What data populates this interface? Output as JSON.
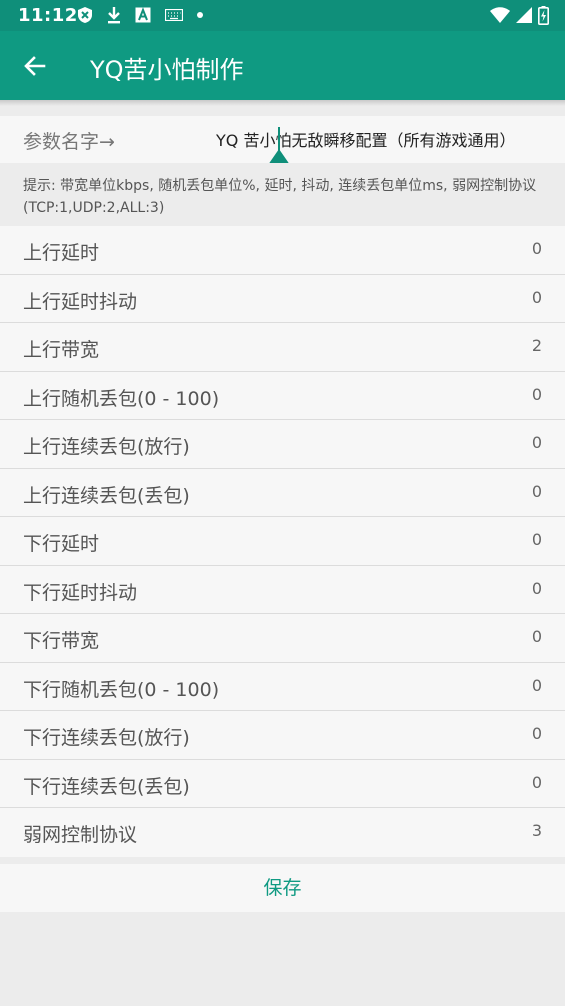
{
  "status_bar": {
    "time": "11:12",
    "left_icons": [
      "shield-x-icon",
      "download-icon",
      "a-box-icon",
      "keyboard-icon",
      "dot-icon"
    ],
    "right_icons": [
      "wifi-icon",
      "signal-icon",
      "battery-charging-icon"
    ]
  },
  "app_bar": {
    "title": "YQ苦小怕制作",
    "back_icon": "arrow-left-icon",
    "color": "#0f9a82"
  },
  "param": {
    "label": "参数名字→",
    "value": "YQ 苦小怕无敌瞬移配置（所有游戏通用）"
  },
  "hint": "提示: 带宽单位kbps, 随机丢包单位%, 延时, 抖动, 连续丢包单位ms, 弱网控制协议(TCP:1,UDP:2,ALL:3)",
  "settings": [
    {
      "label": "上行延时",
      "value": "0"
    },
    {
      "label": "上行延时抖动",
      "value": "0"
    },
    {
      "label": "上行带宽",
      "value": "2"
    },
    {
      "label": "上行随机丢包(0 - 100)",
      "value": "0"
    },
    {
      "label": "上行连续丢包(放行)",
      "value": "0"
    },
    {
      "label": "上行连续丢包(丢包)",
      "value": "0"
    },
    {
      "label": "下行延时",
      "value": "0"
    },
    {
      "label": "下行延时抖动",
      "value": "0"
    },
    {
      "label": "下行带宽",
      "value": "0"
    },
    {
      "label": "下行随机丢包(0 - 100)",
      "value": "0"
    },
    {
      "label": "下行连续丢包(放行)",
      "value": "0"
    },
    {
      "label": "下行连续丢包(丢包)",
      "value": "0"
    },
    {
      "label": "弱网控制协议",
      "value": "3"
    }
  ],
  "save_label": "保存"
}
